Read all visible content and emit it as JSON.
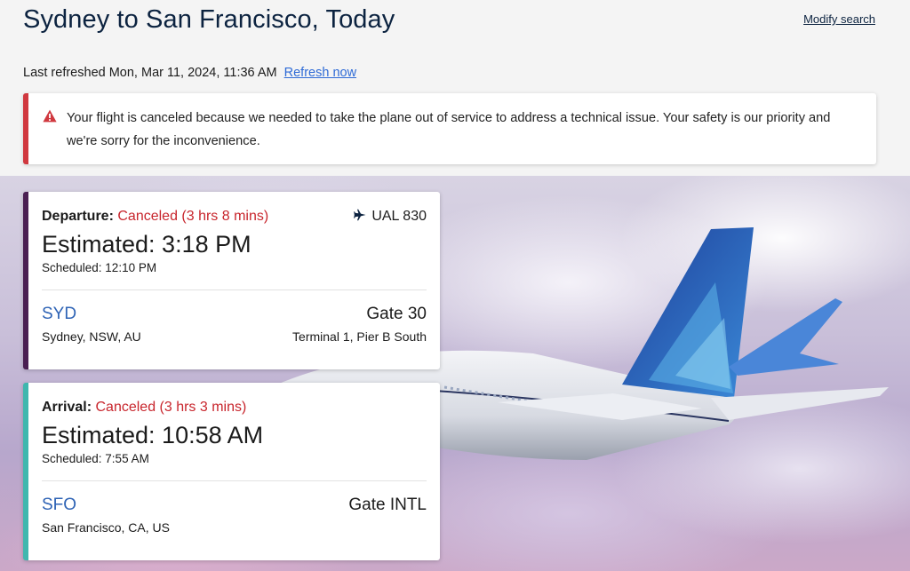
{
  "header": {
    "title": "Sydney to San Francisco, Today",
    "modify_link": "Modify search"
  },
  "refresh": {
    "text": "Last refreshed Mon, Mar 11, 2024, 11:36 AM",
    "link": "Refresh now"
  },
  "alert": {
    "icon": "warning-icon",
    "color": "#d0383f",
    "message": "Your flight is canceled because we needed to take the plane out of service to address a technical issue. Your safety is our priority and we're sorry for the inconvenience."
  },
  "departure": {
    "label": "Departure:",
    "status": "Canceled (3 hrs 8 mins)",
    "flight_icon": "airplane-icon",
    "flight_number": "UAL 830",
    "estimated": "Estimated: 3:18 PM",
    "scheduled": "Scheduled: 12:10 PM",
    "airport_code": "SYD",
    "airport_city": "Sydney, NSW, AU",
    "gate": "Gate 30",
    "terminal": "Terminal 1, Pier B South",
    "accent_color": "#4a1f52"
  },
  "arrival": {
    "label": "Arrival:",
    "status": "Canceled (3 hrs 3 mins)",
    "estimated": "Estimated: 10:58 AM",
    "scheduled": "Scheduled: 7:55 AM",
    "airport_code": "SFO",
    "airport_city": "San Francisco, CA, US",
    "gate": "Gate INTL",
    "accent_color": "#3fb7ae"
  },
  "colors": {
    "title": "#0c2340",
    "canceled": "#c8262d",
    "link": "#2f6bd6",
    "airport_code": "#2e63b5"
  }
}
